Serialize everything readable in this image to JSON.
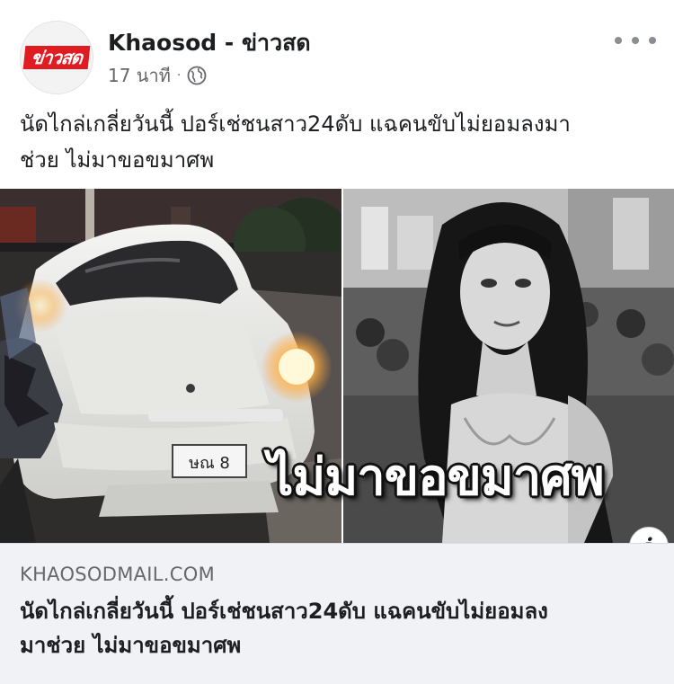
{
  "page": {
    "name": "Khaosod - ข่าวสด",
    "avatar_text": "ข่าวสด",
    "time": "17 นาที",
    "time_separator": "·",
    "privacy_icon": "globe-icon",
    "more_icon": "more-options-icon"
  },
  "post": {
    "text": "นัดไกล่เกลี่ยวันนี้ ปอร์เช่ชนสาว24ดับ แฉคนขับไม่ยอมลงมา\nช่วย ไม่มาขอขมาศพ"
  },
  "link": {
    "image_overlay_text": "ไม่มาขอขมาศพ",
    "plate_text": "ษณ 8",
    "info_icon_glyph": "i",
    "domain": "KHAOSODMAIL.COM",
    "title": "นัดไกล่เกลี่ยวันนี้ ปอร์เช่ชนสาว24ดับ แฉคนขับไม่ยอมลง\nมาช่วย ไม่มาขอขมาศพ"
  },
  "colors": {
    "brand_red": "#e11b22",
    "text_primary": "#1c1e21",
    "text_secondary": "#65676b",
    "link_bg": "#f0f2f5"
  }
}
